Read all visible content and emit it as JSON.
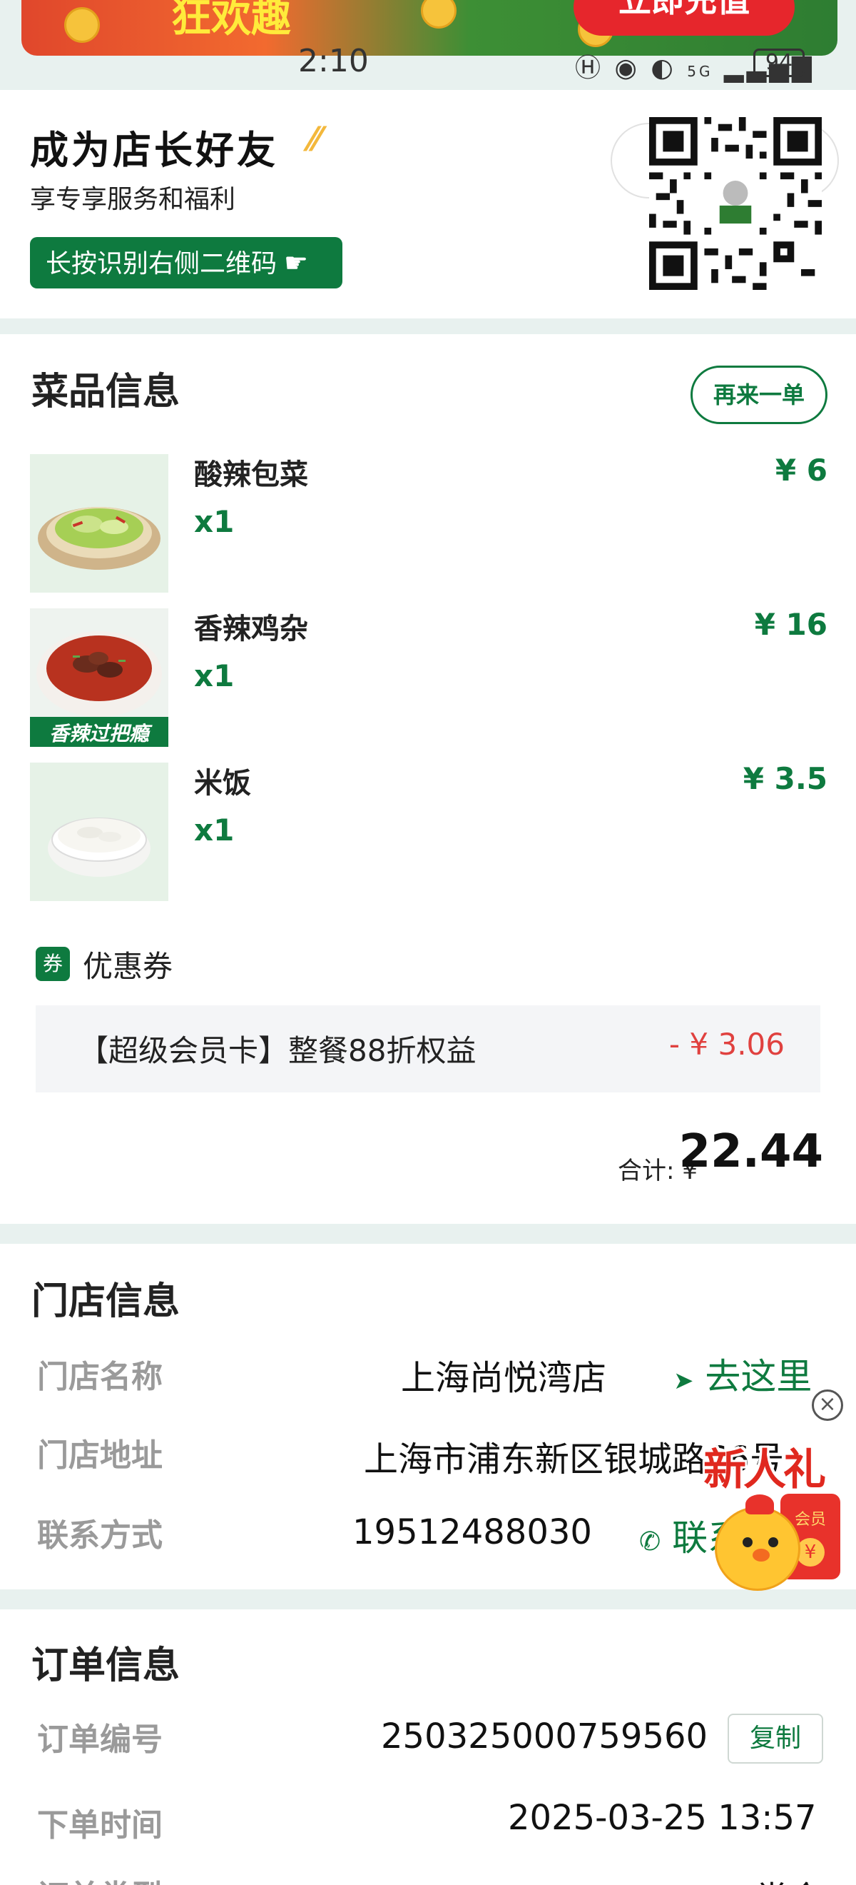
{
  "banner": {
    "headline": "狂欢趣",
    "button_label": "立即充值"
  },
  "status_bar": {
    "time": "2:10",
    "network": "5G",
    "battery": "94"
  },
  "friend_card": {
    "title": "成为店长好友",
    "subtitle": "享专享服务和福利",
    "button_label": "长按识别右侧二维码"
  },
  "dishes": {
    "title": "菜品信息",
    "reorder_label": "再来一单",
    "items": [
      {
        "name": "酸辣包菜",
        "qty": "x1",
        "price": "¥ 6"
      },
      {
        "name": "香辣鸡杂",
        "qty": "x1",
        "price": "¥ 16",
        "tag": "香辣过把瘾"
      },
      {
        "name": "米饭",
        "qty": "x1",
        "price": "¥ 3.5"
      }
    ],
    "coupon": {
      "icon_text": "券",
      "label": "优惠券",
      "name": "【超级会员卡】整餐88折权益",
      "amount": "- ¥ 3.06"
    },
    "total": {
      "label": "合计: ¥",
      "amount": "22.44"
    }
  },
  "store": {
    "title": "门店信息",
    "name_label": "门店名称",
    "name_value": "上海尚悦湾店",
    "navigate_label": "去这里",
    "address_label": "门店地址",
    "address_value": "上海市浦东新区银城路66号",
    "contact_label": "联系方式",
    "phone": "19512488030",
    "contact_link": "联系"
  },
  "order": {
    "title": "订单信息",
    "number_label": "订单编号",
    "number_value": "250325000759560",
    "copy_label": "复制",
    "time_label": "下单时间",
    "time_value": "2025-03-25 13:57",
    "type_label": "订单类型",
    "type_value": "堂食"
  },
  "gift": {
    "text": "新人礼",
    "envelope_text": "会员",
    "coin_text": "¥",
    "close_icon": "×"
  },
  "colors": {
    "brand_green": "#0e7a3f",
    "discount_red": "#e0413f",
    "page_bg": "#e8f1ef"
  }
}
